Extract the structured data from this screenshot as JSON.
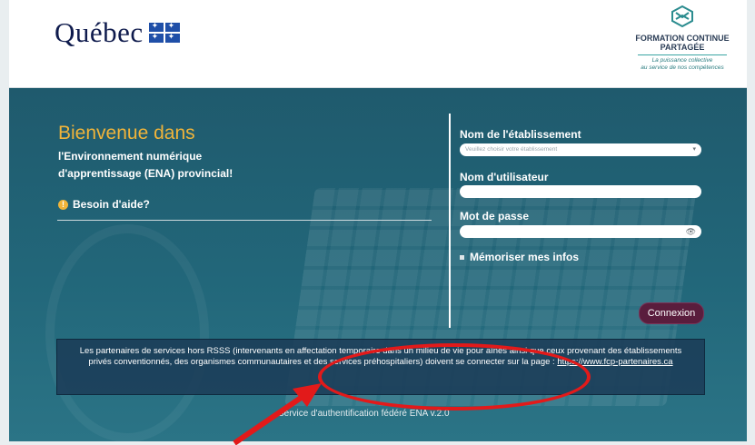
{
  "header": {
    "quebec_word": "Québec",
    "fcp_line1": "FORMATION CONTINUE",
    "fcp_line2": "PARTAGÉE",
    "fcp_tagline1": "La puissance collective",
    "fcp_tagline2": "au service de nos compétences"
  },
  "welcome": {
    "title": "Bienvenue dans",
    "subtitle_line1": "l'Environnement numérique",
    "subtitle_line2": "d'apprentissage (ENA) provincial!",
    "help_label": "Besoin d'aide?"
  },
  "form": {
    "establishment_label": "Nom de l'établissement",
    "establishment_placeholder": "Veuillez choisir votre établissement",
    "username_label": "Nom d'utilisateur",
    "password_label": "Mot de passe",
    "remember_label": "Mémoriser mes infos",
    "submit_label": "Connexion"
  },
  "notice": {
    "text": "Les partenaires de services hors RSSS (intervenants en affectation temporaire dans un milieu de vie pour aînés ainsi que ceux provenant des établissements privés conventionnés, des organismes communautaires et des services préhospitaliers) doivent se connecter sur la page :",
    "link": "https://www.fcp-partenaires.ca"
  },
  "footer": {
    "text": "Service d'authentification fédéré ENA v.2.0"
  },
  "colors": {
    "accent_yellow": "#f0b43a",
    "hero_teal": "#22677a",
    "button": "#5a1d3d",
    "annotation": "#e21a1a"
  }
}
